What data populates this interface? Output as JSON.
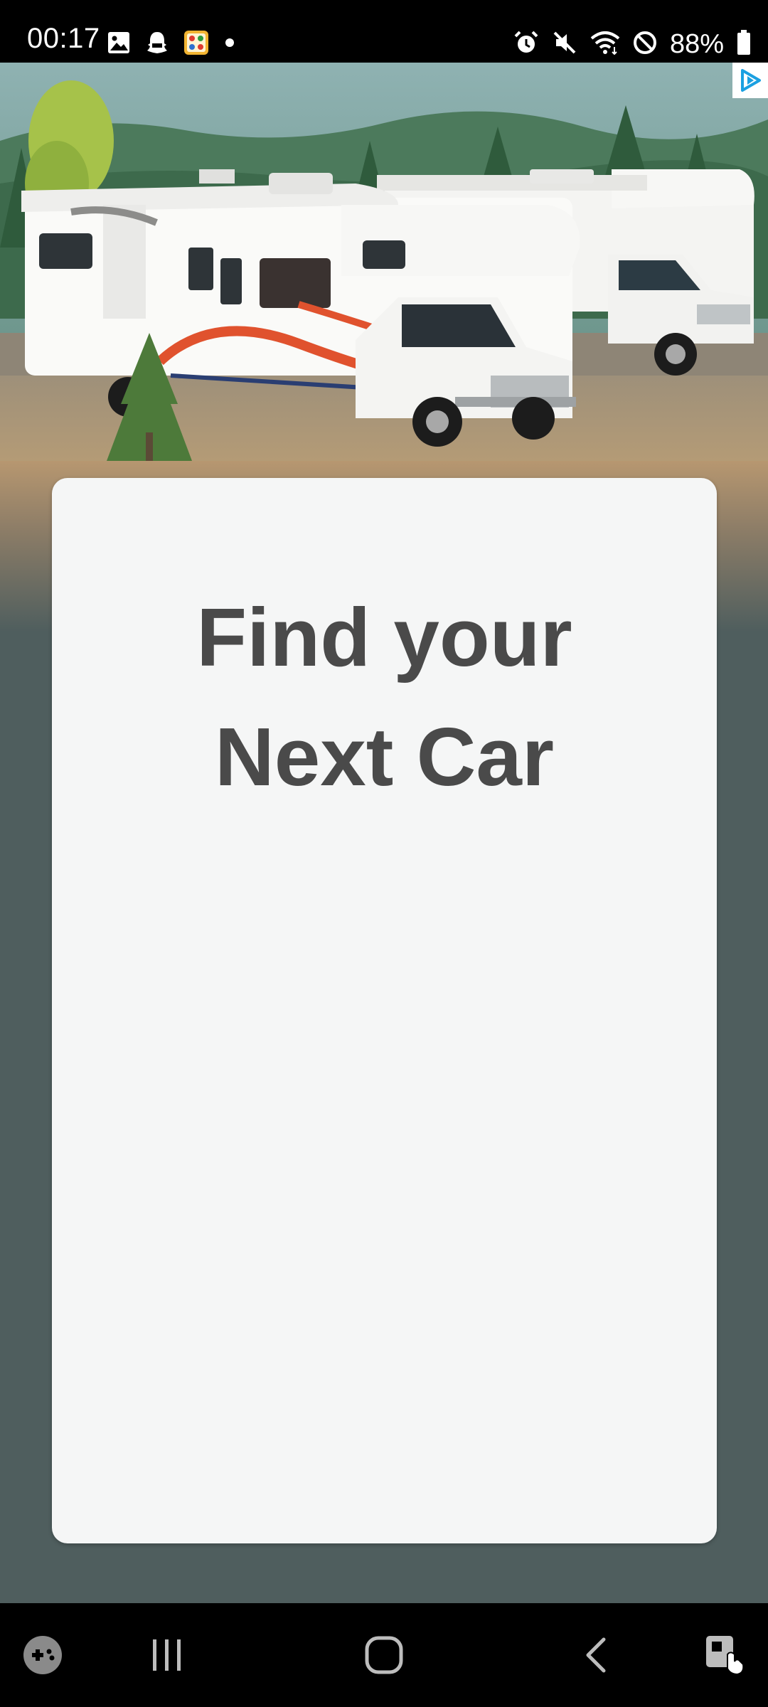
{
  "status_bar": {
    "time": "00:17",
    "left_icons": [
      "image-icon",
      "snapchat-ghost-icon",
      "game-app-icon",
      "notification-dot-icon"
    ],
    "right_icons": [
      "alarm-icon",
      "mute-icon",
      "wifi-icon",
      "do-not-disturb-icon",
      "battery-icon"
    ],
    "battery_text": "88%"
  },
  "ad": {
    "image_description_icon": "rv-campers-photo",
    "ad_choices_icon": "ad-choices-icon"
  },
  "card": {
    "title_line1": "Find your",
    "title_line2": "Next Car"
  },
  "nav_bar": {
    "buttons": [
      "game-launcher-icon",
      "recents-icon",
      "home-icon",
      "back-icon",
      "accessibility-icon"
    ]
  },
  "colors": {
    "status_bar_bg": "#000000",
    "page_bg": "#4f5e5e",
    "card_bg": "#f5f6f6",
    "title_text": "#4a4a4a",
    "ad_choices_blue": "#1ba0e1"
  }
}
